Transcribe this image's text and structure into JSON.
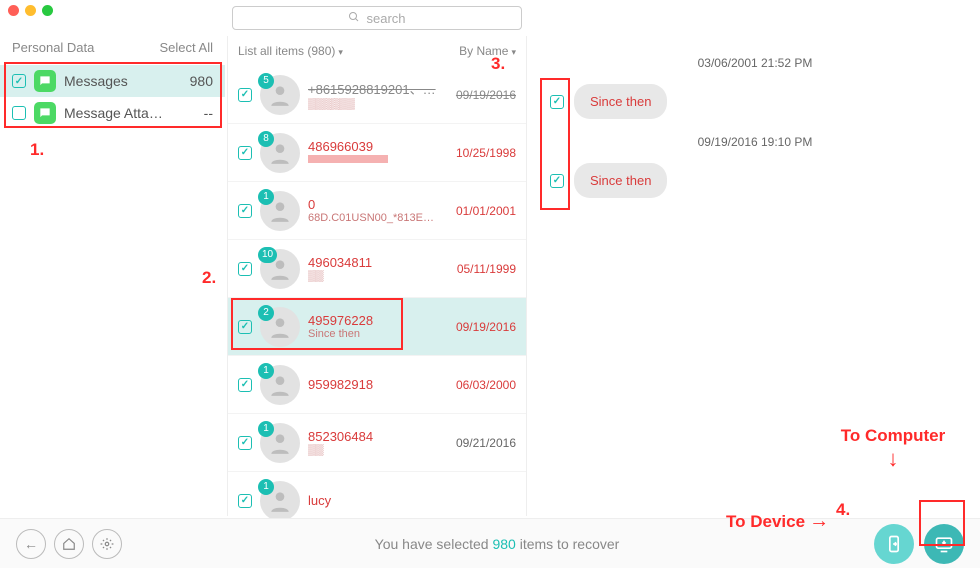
{
  "search": {
    "placeholder": "search"
  },
  "sidebar": {
    "header": "Personal Data",
    "select_all": "Select All",
    "items": [
      {
        "label": "Messages",
        "count": "980",
        "checked": true,
        "selected": true
      },
      {
        "label": "Message Atta…",
        "count": "--",
        "checked": false,
        "selected": false
      }
    ]
  },
  "midcol": {
    "list_label": "List all items (980)",
    "sort_label": "By Name",
    "conversations": [
      {
        "badge": "5",
        "title": "+8615928819201、…",
        "sub": "▒▒▒▒▒▒",
        "date": "09/19/2016",
        "struck": true
      },
      {
        "badge": "8",
        "title": "486966039",
        "sub": "",
        "date": "10/25/1998",
        "redact": true
      },
      {
        "badge": "1",
        "title": "0",
        "sub": "68D.C01USN00_*813E…",
        "date": "01/01/2001"
      },
      {
        "badge": "10",
        "title": "496034811",
        "sub": "▒▒",
        "date": "05/11/1999"
      },
      {
        "badge": "2",
        "title": "495976228",
        "sub": "Since then",
        "date": "09/19/2016",
        "selected": true
      },
      {
        "badge": "1",
        "title": "959982918",
        "sub": "",
        "date": "06/03/2000"
      },
      {
        "badge": "1",
        "title": "852306484",
        "sub": "▒▒",
        "date": "09/21/2016",
        "norm": true
      },
      {
        "badge": "1",
        "title": "lucy",
        "sub": "",
        "date": ""
      }
    ]
  },
  "detail": {
    "times": [
      "03/06/2001 21:52 PM",
      "09/19/2016 19:10 PM"
    ],
    "messages": [
      "Since then",
      "Since then"
    ]
  },
  "footer": {
    "status_pre": "You have selected ",
    "status_num": "980",
    "status_post": " items to recover"
  },
  "annotations": {
    "n1": "1.",
    "n2": "2.",
    "n3": "3.",
    "n4": "4.",
    "to_device": "To Device",
    "to_computer": "To Computer"
  }
}
